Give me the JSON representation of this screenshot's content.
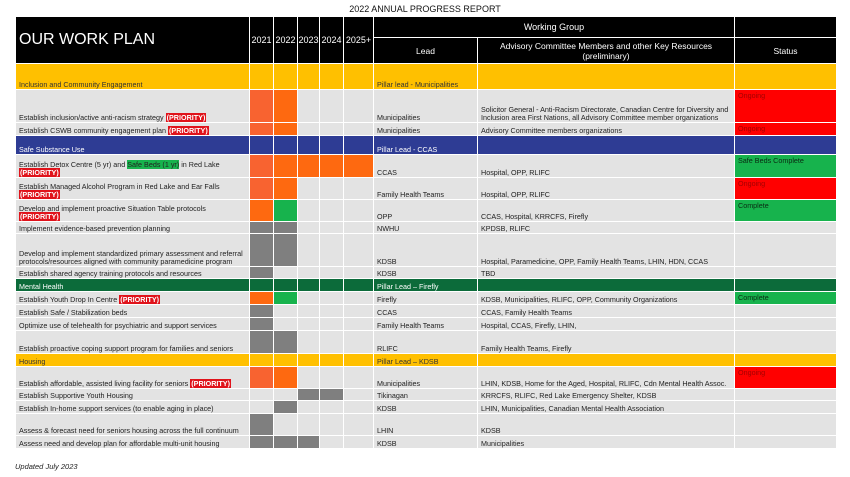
{
  "report_title": "2022 ANNUAL PROGRESS REPORT",
  "header": {
    "plan_title": "OUR WORK PLAN",
    "years": [
      "2021",
      "2022",
      "2023",
      "2024",
      "2025+"
    ],
    "working_group": "Working Group",
    "lead": "Lead",
    "advisory": "Advisory Committee Members and other Key Resources (preliminary)",
    "status": "Status"
  },
  "priority_label": "(PRIORITY)",
  "colors": {
    "orange": "#fe6910",
    "green": "#17b34d",
    "gray": "#7f7f7f",
    "red": "#ff0000",
    "yellow": "#ffc000",
    "blue": "#2e3c94",
    "dark_green": "#0c6b3a"
  },
  "sections": [
    {
      "title": "Inclusion and Community Engagement",
      "pillar": "Pillar lead - Municipalities",
      "rows": [
        {
          "action": "Establish inclusion/active anti-racism strategy",
          "lead": "Municipalities",
          "resources": "Solicitor General - Anti-Racism Directorate, Canadian Centre for Diversity and Inclusion area First Nations, all Advisory Committee member organizations",
          "status": "Ongoing"
        },
        {
          "action": "Establish CSWB community engagement plan",
          "lead": "Municipalities",
          "resources": "Advisory Committee members organizations",
          "status": "Ongoing"
        }
      ]
    },
    {
      "title": "Safe Substance Use",
      "pillar": "Pillar Lead - CCAS",
      "rows": [
        {
          "action_a": "Establish Detox Centre (5 yr) and",
          "action_hl": "Safe Beds (1 yr)",
          "action_b": "in Red Lake",
          "lead": "CCAS",
          "resources": "Hospital, OPP, RLIFC",
          "status": "Safe Beds Complete"
        },
        {
          "action": "Establish Managed Alcohol Program in Red Lake and Ear Falls",
          "lead": "Family Health Teams",
          "resources": "Hospital, OPP, RLIFC",
          "status": "Ongoing"
        },
        {
          "action": "Develop and implement proactive Situation Table protocols",
          "lead": "OPP",
          "resources": "CCAS, Hospital, KRRCFS, Firefly",
          "status": "Complete"
        },
        {
          "action": "Implement evidence-based prevention planning",
          "lead": "NWHU",
          "resources": "KPDSB, RLIFC",
          "status": ""
        },
        {
          "action": "Develop and implement standardized primary assessment and referral protocols/resources aligned with community paramedicine program",
          "lead": "KDSB",
          "resources": "Hospital, Paramedicine, OPP, Family Health Teams, LHIN, HDN, CCAS",
          "status": ""
        },
        {
          "action": "Establish shared agency training protocols and resources",
          "lead": "KDSB",
          "resources": "TBD",
          "status": ""
        }
      ]
    },
    {
      "title": "Mental Health",
      "pillar": "Pillar Lead – Firefly",
      "rows": [
        {
          "action": "Establish Youth Drop In Centre",
          "lead": "Firefly",
          "resources": "KDSB, Municipalities, RLIFC, OPP, Community Organizations",
          "status": "Complete"
        },
        {
          "action": "Establish Safe / Stabilization beds",
          "lead": "CCAS",
          "resources": "CCAS, Family Health Teams",
          "status": ""
        },
        {
          "action": "Optimize use of telehealth for psychiatric and support services",
          "lead": "Family Health Teams",
          "resources": "Hospital, CCAS, Firefly, LHIN,",
          "status": ""
        },
        {
          "action": "Establish proactive coping support program for families and seniors",
          "lead": "RLIFC",
          "resources": "Family Health Teams, Firefly",
          "status": ""
        }
      ]
    },
    {
      "title": "Housing",
      "pillar": "Pillar Lead – KDSB",
      "rows": [
        {
          "action": "Establish affordable, assisted living facility for seniors",
          "lead": "Municipalities",
          "resources": "LHIN, KDSB, Home for the Aged, Hospital, RLIFC, Cdn Mental Health Assoc.",
          "status": "Ongoing"
        },
        {
          "action": "Establish Supportive Youth Housing",
          "lead": "Tikinagan",
          "resources": "KRRCFS, RLIFC, Red Lake Emergency Shelter, KDSB",
          "status": ""
        },
        {
          "action": "Establish In-home support services (to enable aging in place)",
          "lead": "KDSB",
          "resources": "LHIN, Municipalities, Canadian Mental Health Association",
          "status": ""
        },
        {
          "action": "Assess & forecast need for seniors housing across the full continuum",
          "lead": "LHIN",
          "resources": "KDSB",
          "status": ""
        },
        {
          "action": "Assess need and develop plan for affordable multi-unit housing",
          "lead": "KDSB",
          "resources": "Municipalities",
          "status": ""
        }
      ]
    }
  ],
  "footnote": "Updated July 2023"
}
